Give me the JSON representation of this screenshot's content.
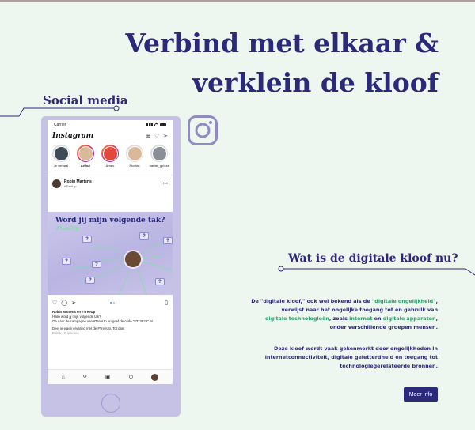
{
  "headline": {
    "line1": "Verbind met elkaar &",
    "line2": "verklein de kloof"
  },
  "social": {
    "title": "Social media"
  },
  "phone": {
    "status": {
      "carrier": "Carrier"
    },
    "app_name": "Instagram",
    "stories": [
      {
        "name": "Je verhaal",
        "bold": false
      },
      {
        "name": "Arthur",
        "bold": true
      },
      {
        "name": "Arneo",
        "bold": false
      },
      {
        "name": "Nicolas",
        "bold": false
      },
      {
        "name": "barbie_girlzzz",
        "bold": false
      }
    ],
    "post": {
      "user": "Robin Martens",
      "subtitle": "#TreeUp",
      "image_title": "Word jij mijn volgende tak?",
      "image_tag": "#TreeUp",
      "caption_user": "Robin Martens en #TreeUp",
      "caption_line1": "Hallo word jij mijn volgende tak?",
      "caption_line2": "Ga naar de campagne van #TreeUp en geef de code \"#323829\" in!",
      "caption_line3": "Deel je eigen ervaring met de #TreeUp, Tot dan!",
      "likes": "Bekijk 10 reacties"
    }
  },
  "digital": {
    "title": "Wat is de digitale kloof nu?",
    "p1": {
      "a": "De \"digitale kloof,\" ook wel bekend als de ",
      "b": "\"digitale ongelijkheid\"",
      "c": ",",
      "d": "verwijst naar het ongelijke toegang tot en gebruik van",
      "e": "digitale technologieën",
      "f": ", zoals ",
      "g": "internet",
      "h": " en ",
      "i": "digitale apparaten",
      "j": ",",
      "k": "onder verschillende groepen mensen."
    },
    "p2": {
      "l1": "Deze kloof wordt vaak gekenmerkt door ongelijkheden in",
      "l2": "internetconnectiviteit, digitale geletterdheid en toegang tot",
      "l3": "technologiegerelateerde bronnen."
    },
    "button_label": "Meer Info"
  },
  "colors": {
    "primary": "#2b2a7a",
    "accent": "#2e9e6a",
    "background": "#eef7ef",
    "phone": "#c5c2e6"
  }
}
